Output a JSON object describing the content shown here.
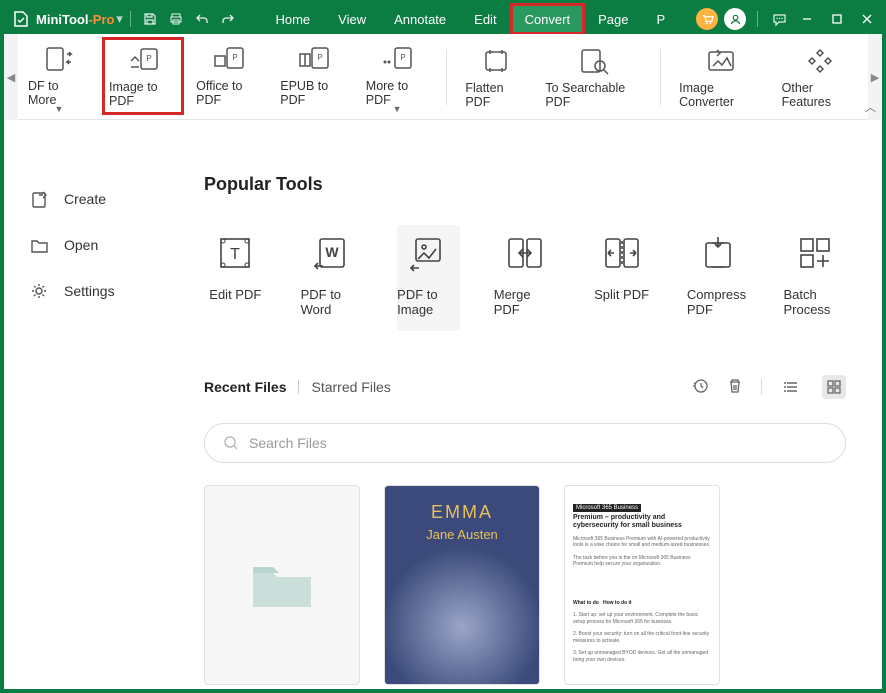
{
  "brand": {
    "name": "MiniTool",
    "suffix": "-Pro"
  },
  "menus": [
    {
      "label": "Home"
    },
    {
      "label": "View"
    },
    {
      "label": "Annotate"
    },
    {
      "label": "Edit"
    },
    {
      "label": "Convert",
      "active": true,
      "highlighted": true
    },
    {
      "label": "Page"
    },
    {
      "label": "P"
    }
  ],
  "ribbon_groups": [
    [
      {
        "label": "DF to More",
        "icon": "doc-convert",
        "dropdown": true,
        "name": "pdf-to-more"
      },
      {
        "label": "Image to PDF",
        "icon": "image-pdf",
        "highlighted": true,
        "name": "image-to-pdf"
      },
      {
        "label": "Office to PDF",
        "icon": "office-pdf",
        "name": "office-to-pdf"
      },
      {
        "label": "EPUB to PDF",
        "icon": "epub-pdf",
        "name": "epub-to-pdf"
      },
      {
        "label": "More to PDF",
        "icon": "more-pdf",
        "dropdown": true,
        "name": "more-to-pdf"
      }
    ],
    [
      {
        "label": "Flatten PDF",
        "icon": "flatten",
        "name": "flatten-pdf"
      },
      {
        "label": "To Searchable PDF",
        "icon": "searchable",
        "name": "searchable-pdf"
      }
    ],
    [
      {
        "label": "Image Converter",
        "icon": "img-conv",
        "name": "image-converter"
      },
      {
        "label": "Other Features",
        "icon": "other",
        "name": "other-features"
      }
    ]
  ],
  "sidebar": [
    {
      "label": "Create",
      "icon": "create",
      "name": "sidebar-create"
    },
    {
      "label": "Open",
      "icon": "open",
      "name": "sidebar-open"
    },
    {
      "label": "Settings",
      "icon": "settings",
      "name": "sidebar-settings"
    }
  ],
  "popular_title": "Popular Tools",
  "tools": [
    {
      "label": "Edit PDF",
      "icon": "edit-pdf"
    },
    {
      "label": "PDF to Word",
      "icon": "pdf-word"
    },
    {
      "label": "PDF to Image",
      "icon": "pdf-image",
      "hover": true
    },
    {
      "label": "Merge PDF",
      "icon": "merge"
    },
    {
      "label": "Split PDF",
      "icon": "split"
    },
    {
      "label": "Compress PDF",
      "icon": "compress"
    },
    {
      "label": "Batch Process",
      "icon": "batch"
    }
  ],
  "file_tabs": {
    "recent": "Recent Files",
    "starred": "Starred Files"
  },
  "search_placeholder": "Search Files",
  "book_thumb": {
    "title": "EMMA",
    "author": "Jane Austen"
  },
  "doc_thumb": {
    "badge": "Microsoft 365 Business",
    "title": "Premium – productivity and cybersecurity for small business"
  }
}
